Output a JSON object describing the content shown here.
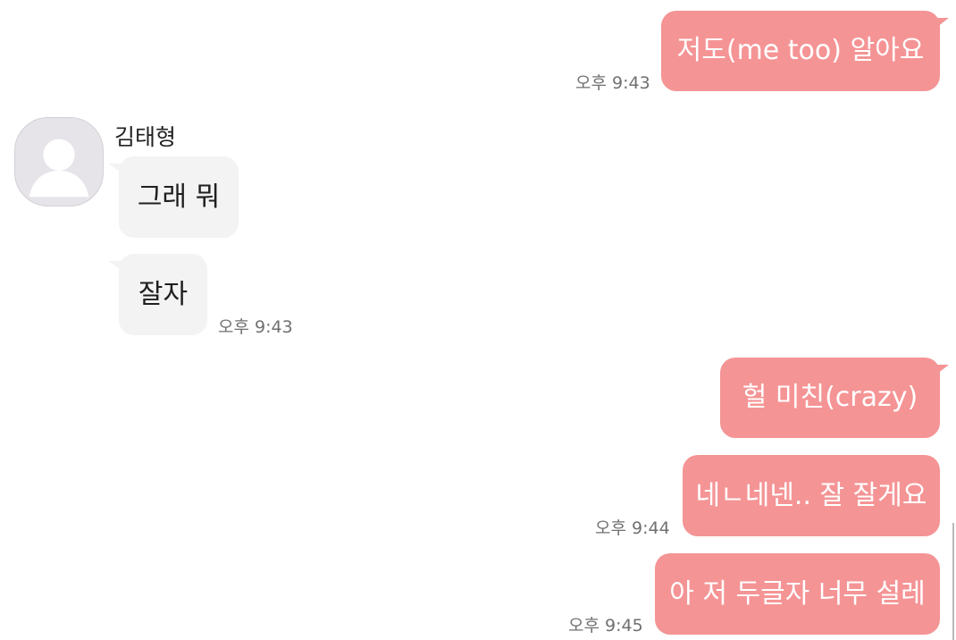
{
  "contact": {
    "name": "김태형",
    "avatar_icon": "person-silhouette-icon"
  },
  "colors": {
    "outgoing_bubble": "#f59495",
    "incoming_bubble": "#f3f3f4",
    "background": "#ffffff"
  },
  "messages": [
    {
      "from": "me",
      "text": "저도(me too) 알아요",
      "time": "오후 9:43"
    },
    {
      "from": "them",
      "text": "그래 뭐",
      "time": ""
    },
    {
      "from": "them",
      "text": "잘자",
      "time": "오후 9:43"
    },
    {
      "from": "me",
      "text": "헐 미친(crazy)",
      "time": ""
    },
    {
      "from": "me",
      "text": "네ㄴ네넨.. 잘 잘게요",
      "time": "오후 9:44"
    },
    {
      "from": "me",
      "text": "아 저 두글자 너무 설레",
      "time": "오후 9:45"
    }
  ]
}
